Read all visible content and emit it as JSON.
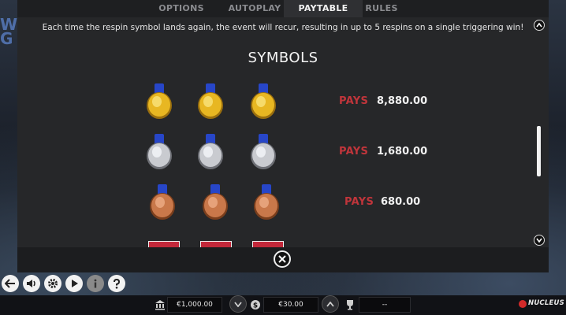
{
  "tabs": [
    {
      "label": "OPTIONS",
      "active": false
    },
    {
      "label": "AUTOPLAY",
      "active": false
    },
    {
      "label": "PAYTABLE",
      "active": true
    },
    {
      "label": "RULES",
      "active": false
    }
  ],
  "paytable": {
    "info_text": "Each time the respin symbol lands again, the event will recur, resulting in up to 5 respins on a single triggering win!",
    "section_title": "SYMBOLS",
    "rows": [
      {
        "medal": "gold-medal-icon",
        "pays_label": "PAYS",
        "pays_value": "8,880.00"
      },
      {
        "medal": "silver-medal-icon",
        "pays_label": "PAYS",
        "pays_value": "1,680.00"
      },
      {
        "medal": "bronze-medal-icon",
        "pays_label": "PAYS",
        "pays_value": "680.00"
      }
    ],
    "partial_row_label": "BAR"
  },
  "colors": {
    "pays_label": "#c0353b",
    "gold": "#e8b722",
    "silver": "#c9cbd0",
    "bronze": "#c9784a",
    "ribbon": "#2746c8"
  },
  "controls": {
    "icons": [
      "back-icon",
      "sound-icon",
      "settings-icon",
      "play-icon",
      "info-icon",
      "help-icon"
    ]
  },
  "bottom_bar": {
    "balance": "€1,000.00",
    "bet": "€30.00",
    "win": "--",
    "brand": "NUCLEUS"
  }
}
